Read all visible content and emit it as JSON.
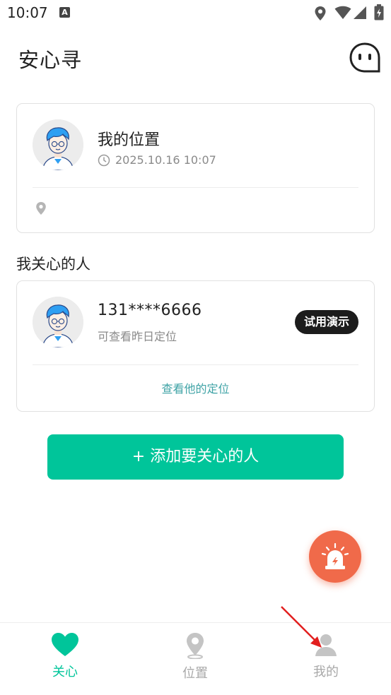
{
  "status_bar": {
    "time": "10:07",
    "notif_letter": "A"
  },
  "header": {
    "title": "安心寻"
  },
  "my_location": {
    "name": "我的位置",
    "time": "2025.10.16 10:07"
  },
  "section": {
    "title": "我关心的人"
  },
  "cared_person": {
    "phone": "131****6666",
    "subtitle": "可查看昨日定位",
    "badge": "试用演示",
    "action": "查看他的定位"
  },
  "add_button": {
    "label": "+ 添加要关心的人"
  },
  "bottom_nav": {
    "items": [
      {
        "label": "关心",
        "icon": "heart-icon",
        "active": true
      },
      {
        "label": "位置",
        "icon": "location-pin-icon",
        "active": false
      },
      {
        "label": "我的",
        "icon": "person-icon",
        "active": false
      }
    ]
  },
  "colors": {
    "accent": "#00c59a",
    "link": "#3fa3a6",
    "alarm": "#f06a4a",
    "inactive": "#bdbdbd",
    "badge_bg": "#1c1c1c"
  }
}
